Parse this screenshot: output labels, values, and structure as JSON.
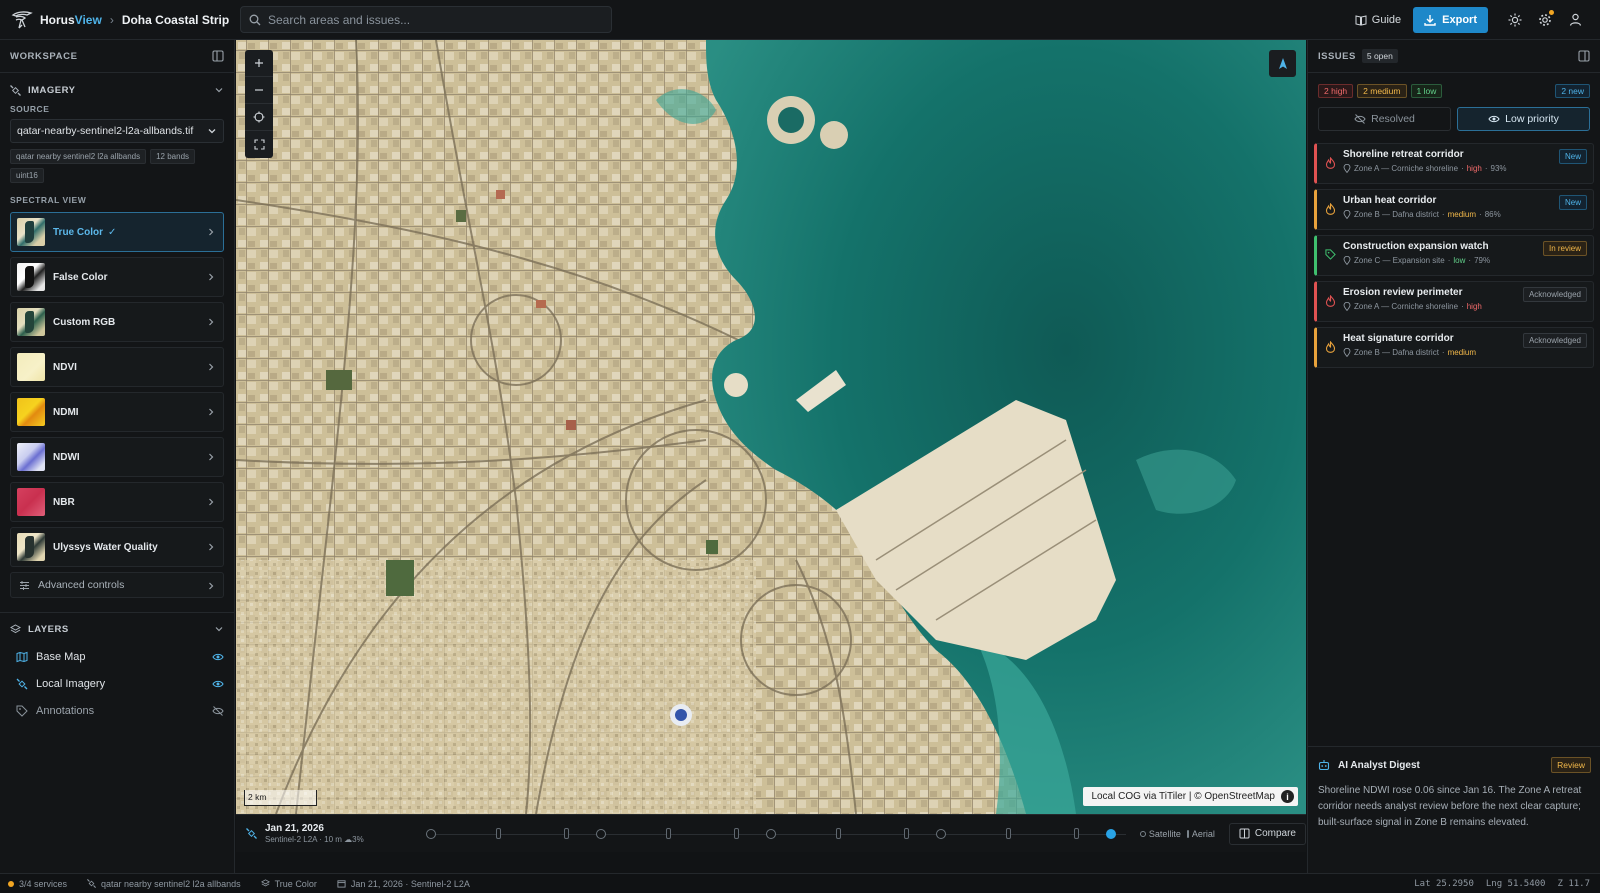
{
  "app": {
    "brand_a": "Horus",
    "brand_b": "View",
    "project": "Doha Coastal Strip"
  },
  "search": {
    "placeholder": "Search areas and issues..."
  },
  "toolbar": {
    "guide_label": "Guide",
    "export_label": "Export"
  },
  "workspace": {
    "title": "WORKSPACE",
    "imagery_title": "IMAGERY",
    "source_label": "SOURCE",
    "source_value": "qatar-nearby-sentinel2-l2a-allbands.tif",
    "chips": [
      "qatar nearby sentinel2 l2a allbands",
      "12 bands",
      "uint16"
    ],
    "spectral_title": "SPECTRAL VIEW",
    "spectral": [
      {
        "name": "True Color",
        "active": true,
        "thumb": "truecolor"
      },
      {
        "name": "False Color",
        "active": false,
        "thumb": "falsecolor"
      },
      {
        "name": "Custom RGB",
        "active": false,
        "thumb": "customrgb"
      },
      {
        "name": "NDVI",
        "active": false,
        "thumb": "ndvi"
      },
      {
        "name": "NDMI",
        "active": false,
        "thumb": "ndmi"
      },
      {
        "name": "NDWI",
        "active": false,
        "thumb": "ndwi"
      },
      {
        "name": "NBR",
        "active": false,
        "thumb": "nbr"
      },
      {
        "name": "Ulyssys Water Quality",
        "active": false,
        "thumb": "uwq"
      }
    ],
    "advanced_label": "Advanced controls",
    "layers_title": "LAYERS",
    "layers": [
      {
        "name": "Base Map",
        "visible": true
      },
      {
        "name": "Local Imagery",
        "visible": true
      },
      {
        "name": "Annotations",
        "visible": false
      }
    ]
  },
  "map": {
    "scale_label": "2 km",
    "attribution": "Local COG via TiTiler | © OpenStreetMap"
  },
  "timeline": {
    "date": "Jan 21, 2026",
    "meta": "Sentinel-2 L2A · 10 m",
    "cloud": "3%",
    "satellite_label": "Satellite",
    "aerial_label": "Aerial",
    "compare_label": "Compare"
  },
  "issues": {
    "title": "ISSUES",
    "open_count": "5 open",
    "sev_high": "2 high",
    "sev_medium": "2 medium",
    "sev_low": "1 low",
    "new_count": "2 new",
    "filter_resolved": "Resolved",
    "filter_low": "Low priority",
    "items": [
      {
        "title": "Shoreline retreat corridor",
        "zone": "Zone A — Corniche shoreline",
        "severity": "high",
        "confidence": "93%",
        "status": "New",
        "status_kind": "new",
        "icon": "flame"
      },
      {
        "title": "Urban heat corridor",
        "zone": "Zone B — Dafna district",
        "severity": "medium",
        "confidence": "86%",
        "status": "New",
        "status_kind": "new",
        "icon": "flame"
      },
      {
        "title": "Construction expansion watch",
        "zone": "Zone C — Expansion site",
        "severity": "low",
        "confidence": "79%",
        "status": "In review",
        "status_kind": "review",
        "icon": "tag"
      },
      {
        "title": "Erosion review perimeter",
        "zone": "Zone A — Corniche shoreline",
        "severity": "high",
        "confidence": "",
        "status": "Acknowledged",
        "status_kind": "ack",
        "icon": "flame"
      },
      {
        "title": "Heat signature corridor",
        "zone": "Zone B — Dafna district",
        "severity": "medium",
        "confidence": "",
        "status": "Acknowledged",
        "status_kind": "ack",
        "icon": "flame"
      }
    ]
  },
  "digest": {
    "title": "AI Analyst Digest",
    "badge": "Review",
    "text": "Shoreline NDWI rose 0.06 since Jan 16. The Zone A retreat corridor needs analyst review before the next clear capture; built-surface signal in Zone B remains elevated."
  },
  "status": {
    "services": "3/4 services",
    "dataset": "qatar nearby sentinel2 l2a allbands",
    "view": "True Color",
    "capture": "Jan 21, 2026 · Sentinel-2 L2A",
    "lat": "Lat 25.2950",
    "lng": "Lng 51.5400",
    "zoom": "Z 11.7"
  },
  "colors": {
    "accent": "#1e88c9",
    "high": "#e05252",
    "medium": "#e8a23c",
    "low": "#3fbf6e"
  }
}
